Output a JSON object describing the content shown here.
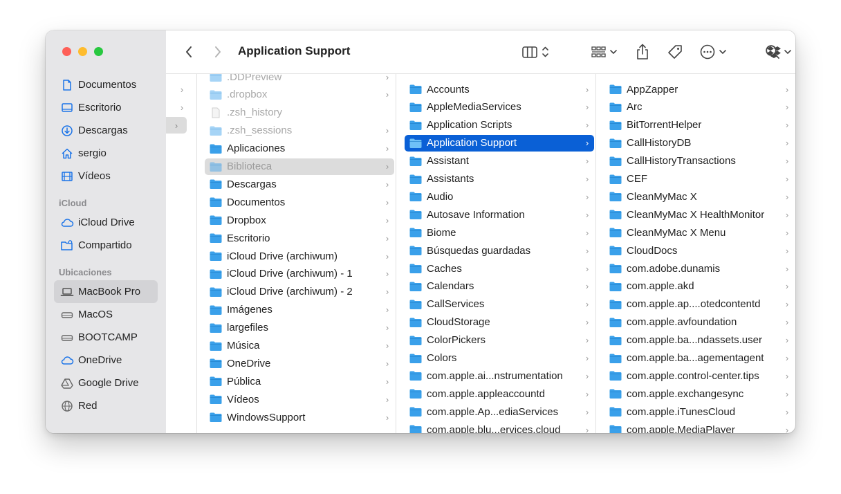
{
  "window": {
    "title": "Application Support"
  },
  "colors": {
    "accent": "#0a60d6",
    "folder": "#3aa0ea",
    "traffic_close": "#fe5f57",
    "traffic_min": "#febc2e",
    "traffic_max": "#28c840"
  },
  "sidebar": {
    "favorites": [
      {
        "label": "Documentos",
        "icon": "document-icon"
      },
      {
        "label": "Escritorio",
        "icon": "desktop-icon"
      },
      {
        "label": "Descargas",
        "icon": "download-icon"
      },
      {
        "label": "sergio",
        "icon": "home-icon"
      },
      {
        "label": "Vídeos",
        "icon": "film-icon"
      }
    ],
    "icloud_title": "iCloud",
    "icloud": [
      {
        "label": "iCloud Drive",
        "icon": "cloud-icon"
      },
      {
        "label": "Compartido",
        "icon": "shared-folder-icon"
      }
    ],
    "locations_title": "Ubicaciones",
    "locations": [
      {
        "label": "MacBook Pro",
        "icon": "laptop-icon",
        "selected": true
      },
      {
        "label": "MacOS",
        "icon": "drive-icon"
      },
      {
        "label": "BOOTCAMP",
        "icon": "drive-icon"
      },
      {
        "label": "OneDrive",
        "icon": "cloud-icon"
      },
      {
        "label": "Google Drive",
        "icon": "google-drive-icon"
      },
      {
        "label": "Red",
        "icon": "globe-icon"
      }
    ]
  },
  "columns": [
    {
      "items": [
        {
          "name": ".DDPreview",
          "kind": "folder",
          "dim": true,
          "chevron": true
        },
        {
          "name": ".dropbox",
          "kind": "folder",
          "dim": true,
          "chevron": true
        },
        {
          "name": ".zsh_history",
          "kind": "file",
          "dim": true,
          "chevron": false
        },
        {
          "name": ".zsh_sessions",
          "kind": "folder",
          "dim": true,
          "chevron": true
        },
        {
          "name": "Aplicaciones",
          "kind": "folder",
          "chevron": true
        },
        {
          "name": "Biblioteca",
          "kind": "folder",
          "path": true,
          "chevron": true
        },
        {
          "name": "Descargas",
          "kind": "folder",
          "chevron": true
        },
        {
          "name": "Documentos",
          "kind": "folder",
          "chevron": true
        },
        {
          "name": "Dropbox",
          "kind": "folder",
          "chevron": true
        },
        {
          "name": "Escritorio",
          "kind": "folder",
          "chevron": true
        },
        {
          "name": "iCloud Drive (archiwum)",
          "kind": "folder",
          "chevron": true
        },
        {
          "name": "iCloud Drive (archiwum) - 1",
          "kind": "folder",
          "chevron": true
        },
        {
          "name": "iCloud Drive (archiwum) - 2",
          "kind": "folder",
          "chevron": true
        },
        {
          "name": "Imágenes",
          "kind": "folder",
          "chevron": true
        },
        {
          "name": "largefiles",
          "kind": "folder",
          "chevron": true
        },
        {
          "name": "Música",
          "kind": "folder",
          "chevron": true
        },
        {
          "name": "OneDrive",
          "kind": "folder",
          "chevron": true
        },
        {
          "name": "Pública",
          "kind": "folder",
          "chevron": true
        },
        {
          "name": "Vídeos",
          "kind": "folder",
          "chevron": true
        },
        {
          "name": "WindowsSupport",
          "kind": "folder",
          "chevron": true
        }
      ]
    },
    {
      "items": [
        {
          "name": "Accounts",
          "kind": "folder",
          "chevron": true
        },
        {
          "name": "AppleMediaServices",
          "kind": "folder",
          "chevron": true
        },
        {
          "name": "Application Scripts",
          "kind": "folder",
          "chevron": true
        },
        {
          "name": "Application Support",
          "kind": "folder",
          "selected": true,
          "chevron": true
        },
        {
          "name": "Assistant",
          "kind": "folder",
          "chevron": true
        },
        {
          "name": "Assistants",
          "kind": "folder",
          "chevron": true
        },
        {
          "name": "Audio",
          "kind": "folder",
          "chevron": true
        },
        {
          "name": "Autosave Information",
          "kind": "folder",
          "chevron": true
        },
        {
          "name": "Biome",
          "kind": "folder",
          "chevron": true
        },
        {
          "name": "Búsquedas guardadas",
          "kind": "folder",
          "chevron": true
        },
        {
          "name": "Caches",
          "kind": "folder",
          "chevron": true
        },
        {
          "name": "Calendars",
          "kind": "folder",
          "chevron": true
        },
        {
          "name": "CallServices",
          "kind": "folder",
          "chevron": true
        },
        {
          "name": "CloudStorage",
          "kind": "folder",
          "chevron": true
        },
        {
          "name": "ColorPickers",
          "kind": "folder",
          "chevron": true
        },
        {
          "name": "Colors",
          "kind": "folder",
          "chevron": true
        },
        {
          "name": "com.apple.ai...nstrumentation",
          "kind": "folder",
          "chevron": true
        },
        {
          "name": "com.apple.appleaccountd",
          "kind": "folder",
          "chevron": true
        },
        {
          "name": "com.apple.Ap...ediaServices",
          "kind": "folder",
          "chevron": true
        },
        {
          "name": "com.apple.blu...ervices.cloud",
          "kind": "folder",
          "chevron": true
        }
      ]
    },
    {
      "items": [
        {
          "name": "AppZapper",
          "kind": "folder",
          "chevron": true
        },
        {
          "name": "Arc",
          "kind": "folder",
          "chevron": true
        },
        {
          "name": "BitTorrentHelper",
          "kind": "folder",
          "chevron": true
        },
        {
          "name": "CallHistoryDB",
          "kind": "folder",
          "chevron": true
        },
        {
          "name": "CallHistoryTransactions",
          "kind": "folder",
          "chevron": true
        },
        {
          "name": "CEF",
          "kind": "folder",
          "chevron": true
        },
        {
          "name": "CleanMyMac X",
          "kind": "folder",
          "chevron": true
        },
        {
          "name": "CleanMyMac X HealthMonitor",
          "kind": "folder",
          "chevron": true
        },
        {
          "name": "CleanMyMac X Menu",
          "kind": "folder",
          "chevron": true
        },
        {
          "name": "CloudDocs",
          "kind": "folder",
          "chevron": true
        },
        {
          "name": "com.adobe.dunamis",
          "kind": "folder",
          "chevron": true
        },
        {
          "name": "com.apple.akd",
          "kind": "folder",
          "chevron": true
        },
        {
          "name": "com.apple.ap....otedcontentd",
          "kind": "folder",
          "chevron": true
        },
        {
          "name": "com.apple.avfoundation",
          "kind": "folder",
          "chevron": true
        },
        {
          "name": "com.apple.ba...ndassets.user",
          "kind": "folder",
          "chevron": true
        },
        {
          "name": "com.apple.ba...agementagent",
          "kind": "folder",
          "chevron": true
        },
        {
          "name": "com.apple.control-center.tips",
          "kind": "folder",
          "chevron": true
        },
        {
          "name": "com.apple.exchangesync",
          "kind": "folder",
          "chevron": true
        },
        {
          "name": "com.apple.iTunesCloud",
          "kind": "folder",
          "chevron": true
        },
        {
          "name": "com.apple.MediaPlayer",
          "kind": "folder",
          "chevron": true
        }
      ]
    }
  ],
  "toolbar_icons": [
    "back-icon",
    "forward-icon",
    "column-view-icon",
    "group-icon",
    "share-icon",
    "tag-icon",
    "more-icon",
    "dropbox-icon",
    "search-icon"
  ]
}
